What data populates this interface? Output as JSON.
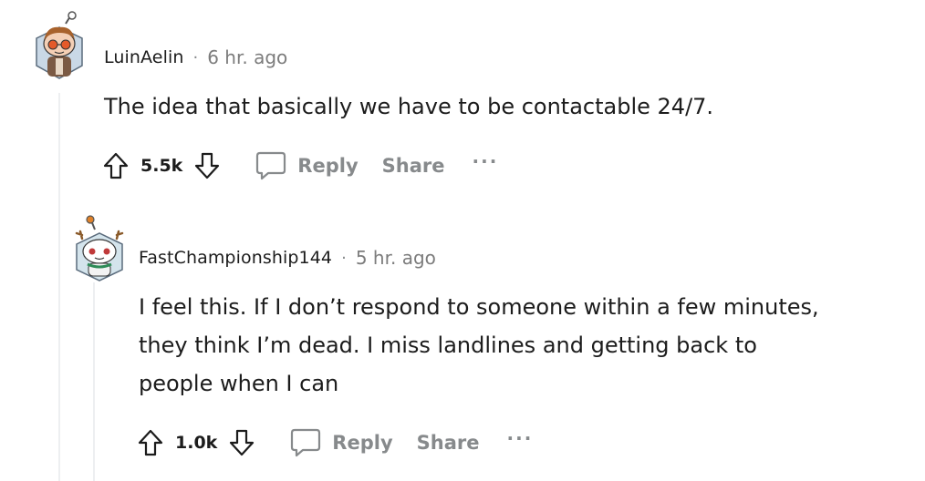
{
  "comments": [
    {
      "username": "LuinAelin",
      "separator": "·",
      "time": "6 hr. ago",
      "body_lines": [
        "The idea that basically we have to be contactable 24/7."
      ],
      "votes": "5.5k",
      "reply_label": "Reply",
      "share_label": "Share",
      "more_label": "···"
    },
    {
      "username": "FastChampionship144",
      "separator": "·",
      "time": "5 hr. ago",
      "body_lines": [
        "I feel this. If I don’t respond to someone within a few minutes,",
        "they think I’m dead.  I miss landlines and getting back to",
        "people when I can"
      ],
      "votes": "1.0k",
      "reply_label": "Reply",
      "share_label": "Share",
      "more_label": "···"
    }
  ],
  "icons": [
    "upvote-icon",
    "downvote-icon",
    "comment-icon",
    "more-icon"
  ],
  "colors": {
    "muted": "#878a8c",
    "text": "#1c1c1c",
    "thread_line": "#edeff1"
  }
}
